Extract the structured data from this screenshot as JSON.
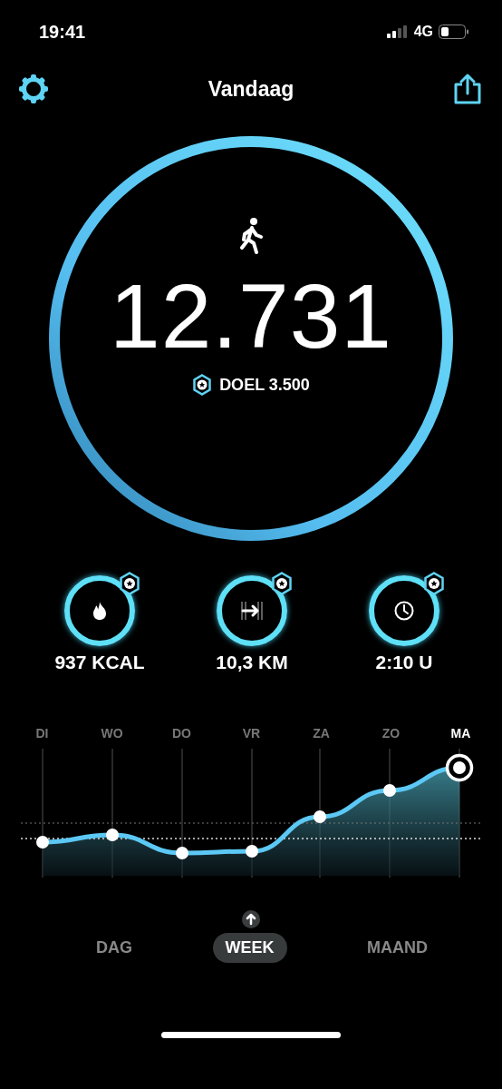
{
  "status_bar": {
    "time": "19:41",
    "network": "4G"
  },
  "nav": {
    "title": "Vandaag"
  },
  "steps": {
    "value": "12.731",
    "goal": "DOEL 3.500"
  },
  "stats": [
    {
      "kind": "calories",
      "value": "937 KCAL",
      "goal_reached": true
    },
    {
      "kind": "distance",
      "value": "10,3 KM",
      "goal_reached": true
    },
    {
      "kind": "time",
      "value": "2:10 U",
      "goal_reached": true
    }
  ],
  "days": [
    {
      "label": "DI",
      "selected": false
    },
    {
      "label": "WO",
      "selected": false
    },
    {
      "label": "DO",
      "selected": false
    },
    {
      "label": "VR",
      "selected": false
    },
    {
      "label": "ZA",
      "selected": false
    },
    {
      "label": "ZO",
      "selected": false
    },
    {
      "label": "MA",
      "selected": true
    }
  ],
  "periods": [
    {
      "label": "DAG",
      "selected": false
    },
    {
      "label": "WEEK",
      "selected": true
    },
    {
      "label": "MAAND",
      "selected": false
    }
  ]
}
